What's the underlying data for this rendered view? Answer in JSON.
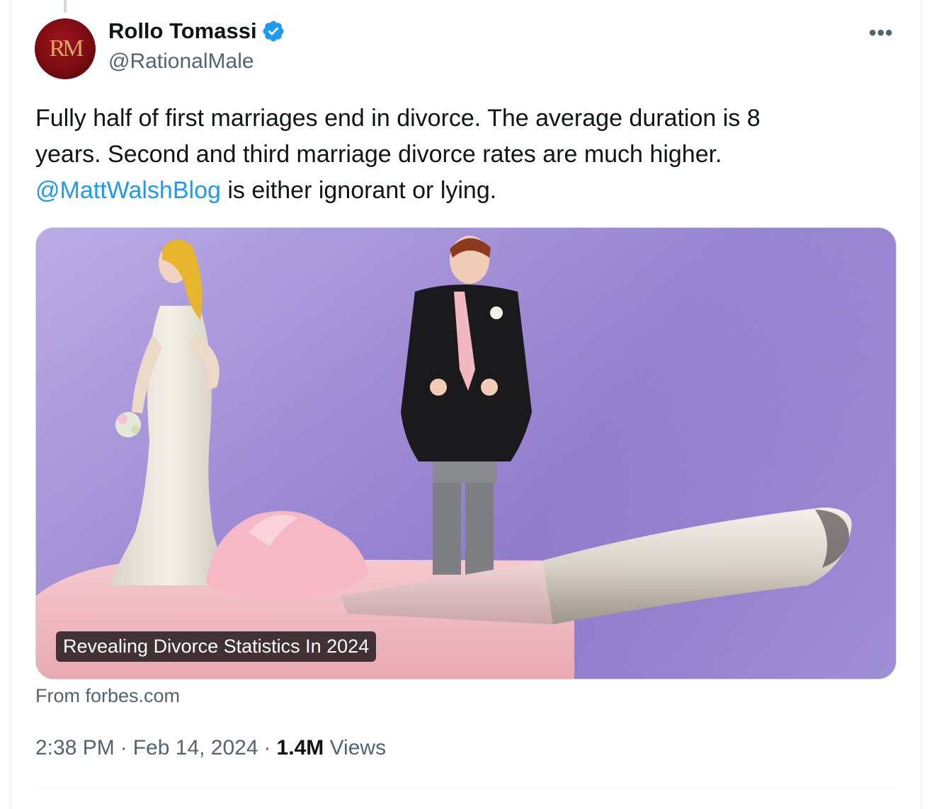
{
  "tweet": {
    "author": {
      "display_name": "Rollo Tomassi",
      "handle": "@RationalMale",
      "avatar_initials": "RM",
      "verified": true
    },
    "text": {
      "line_1": "Fully half of first marriages end in divorce. The average duration is 8",
      "line_2": "years. Second and third marriage divorce rates are much higher.",
      "mention": "@MattWalshBlog",
      "line_3_rest": " is either ignorant or lying."
    },
    "card": {
      "title": "Revealing Divorce Statistics In 2024",
      "source": "From forbes.com"
    },
    "meta": {
      "time": "2:38 PM",
      "separator": "·",
      "date": "Feb 14, 2024",
      "views_count": "1.4M",
      "views_label": "Views"
    },
    "more_icon": "more-horizontal-icon",
    "colors": {
      "accent": "#1d9bf0",
      "secondary_text": "#536471",
      "primary_text": "#0f1419"
    }
  }
}
